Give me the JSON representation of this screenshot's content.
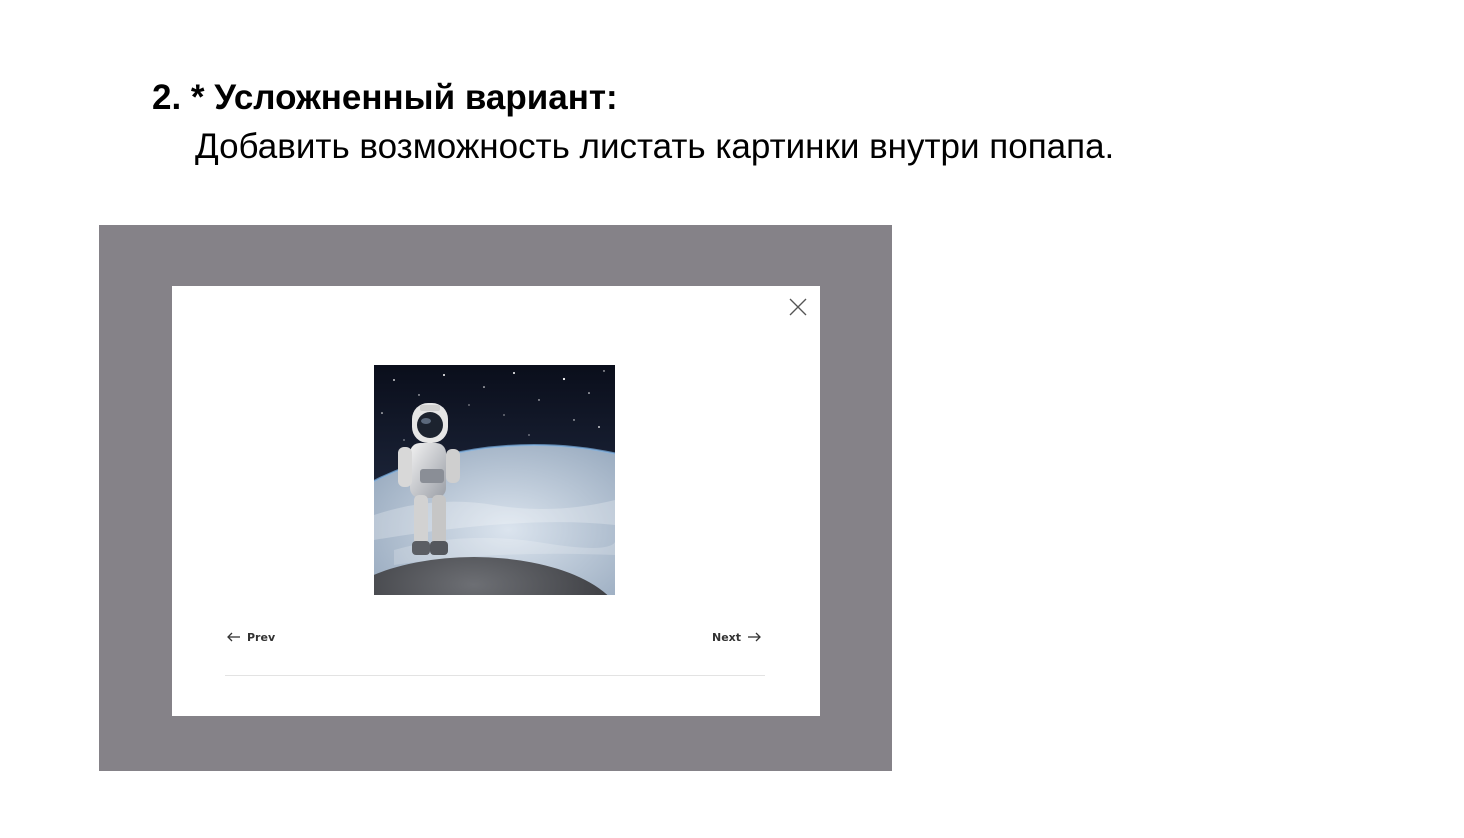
{
  "slide": {
    "heading": "2. * Усложненный вариант:",
    "description": "Добавить возможность листать картинки внутри попапа."
  },
  "popup": {
    "close_icon": "close-icon",
    "image_subject": "astronaut-in-space-photo",
    "prev_label": "Prev",
    "next_label": "Next",
    "prev_icon": "arrow-left-icon",
    "next_icon": "arrow-right-icon"
  },
  "colors": {
    "overlay": "#858288",
    "popup_background": "#ffffff",
    "text": "#000000"
  }
}
